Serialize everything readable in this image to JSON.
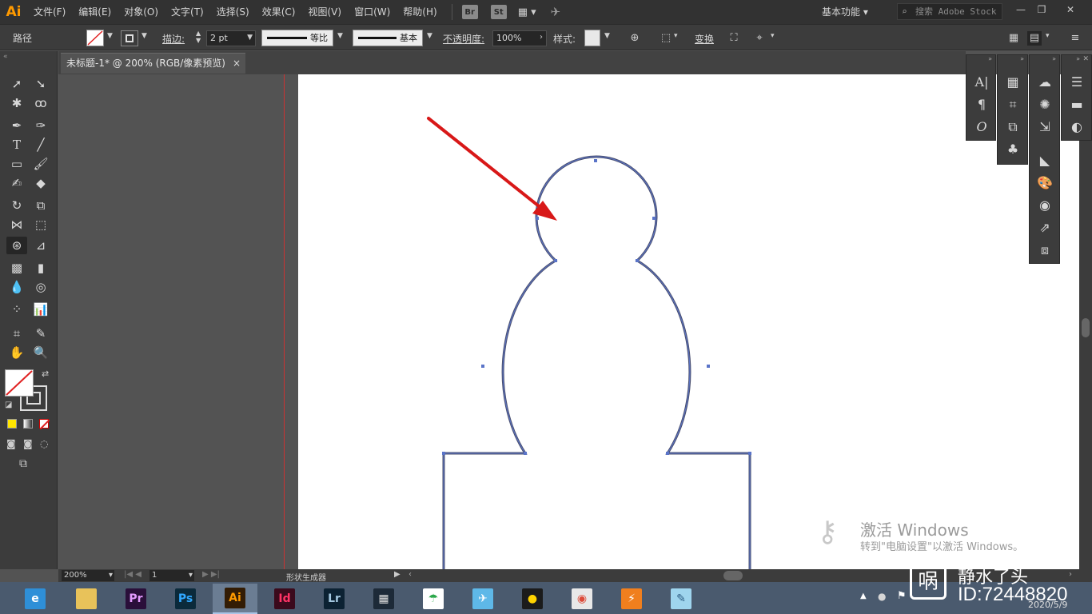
{
  "app": {
    "logo": "Ai",
    "menu": [
      "文件(F)",
      "编辑(E)",
      "对象(O)",
      "文字(T)",
      "选择(S)",
      "效果(C)",
      "视图(V)",
      "窗口(W)",
      "帮助(H)"
    ],
    "bridge_buttons": [
      "Br",
      "St"
    ],
    "workspace": "基本功能",
    "stock_search_placeholder": "搜索 Adobe Stock"
  },
  "controlbar": {
    "selection_type": "路径",
    "stroke_label": "描边:",
    "stroke_value": "2 pt",
    "profile_label": "等比",
    "brush_label": "基本",
    "opacity_label": "不透明度:",
    "opacity_value": "100%",
    "style_label": "样式:",
    "transform_label": "变换"
  },
  "document": {
    "tab_title": "未标题-1* @ 200% (RGB/像素预览)",
    "close_glyph": "×"
  },
  "statusbar": {
    "zoom": "200%",
    "artboard_number": "1",
    "tool_name": "形状生成器"
  },
  "watermarks": {
    "activate_title": "激活 Windows",
    "activate_sub": "转到\"电脑设置\"以激活 Windows。",
    "brand": "静水了头",
    "id": "ID:72448820",
    "date": "2020/5/9"
  },
  "taskbar": {
    "apps": [
      {
        "name": "browser",
        "label": "e",
        "color": "#2e8fd8"
      },
      {
        "name": "explorer",
        "label": "",
        "color": "#e8c25a"
      },
      {
        "name": "premiere",
        "label": "Pr",
        "color": "#2a0f3a",
        "fg": "#e49bff"
      },
      {
        "name": "photoshop",
        "label": "Ps",
        "color": "#0b2a3b",
        "fg": "#31a8ff"
      },
      {
        "name": "illustrator",
        "label": "Ai",
        "color": "#331c04",
        "fg": "#ff9a00"
      },
      {
        "name": "indesign",
        "label": "Id",
        "color": "#3b0a1c",
        "fg": "#ff3366"
      },
      {
        "name": "lightroom",
        "label": "Lr",
        "color": "#0c2233",
        "fg": "#a4c8e1"
      },
      {
        "name": "video",
        "label": "▦",
        "color": "#1d2a38",
        "fg": "#e0e0e0"
      },
      {
        "name": "umbrella",
        "label": "☂",
        "color": "#ffffff",
        "fg": "#2ca84b"
      },
      {
        "name": "bird",
        "label": "✈",
        "color": "#5eb8e8",
        "fg": "#ffffff"
      },
      {
        "name": "qq",
        "label": "●",
        "color": "#1b1b1b",
        "fg": "#ffd300"
      },
      {
        "name": "chrome",
        "label": "◉",
        "color": "#e8e8e8",
        "fg": "#dd4b39"
      },
      {
        "name": "thunder",
        "label": "⚡",
        "color": "#f07f1e",
        "fg": "#ffffff"
      },
      {
        "name": "notes",
        "label": "✎",
        "color": "#9fd5ee",
        "fg": "#2b5b82"
      }
    ]
  }
}
